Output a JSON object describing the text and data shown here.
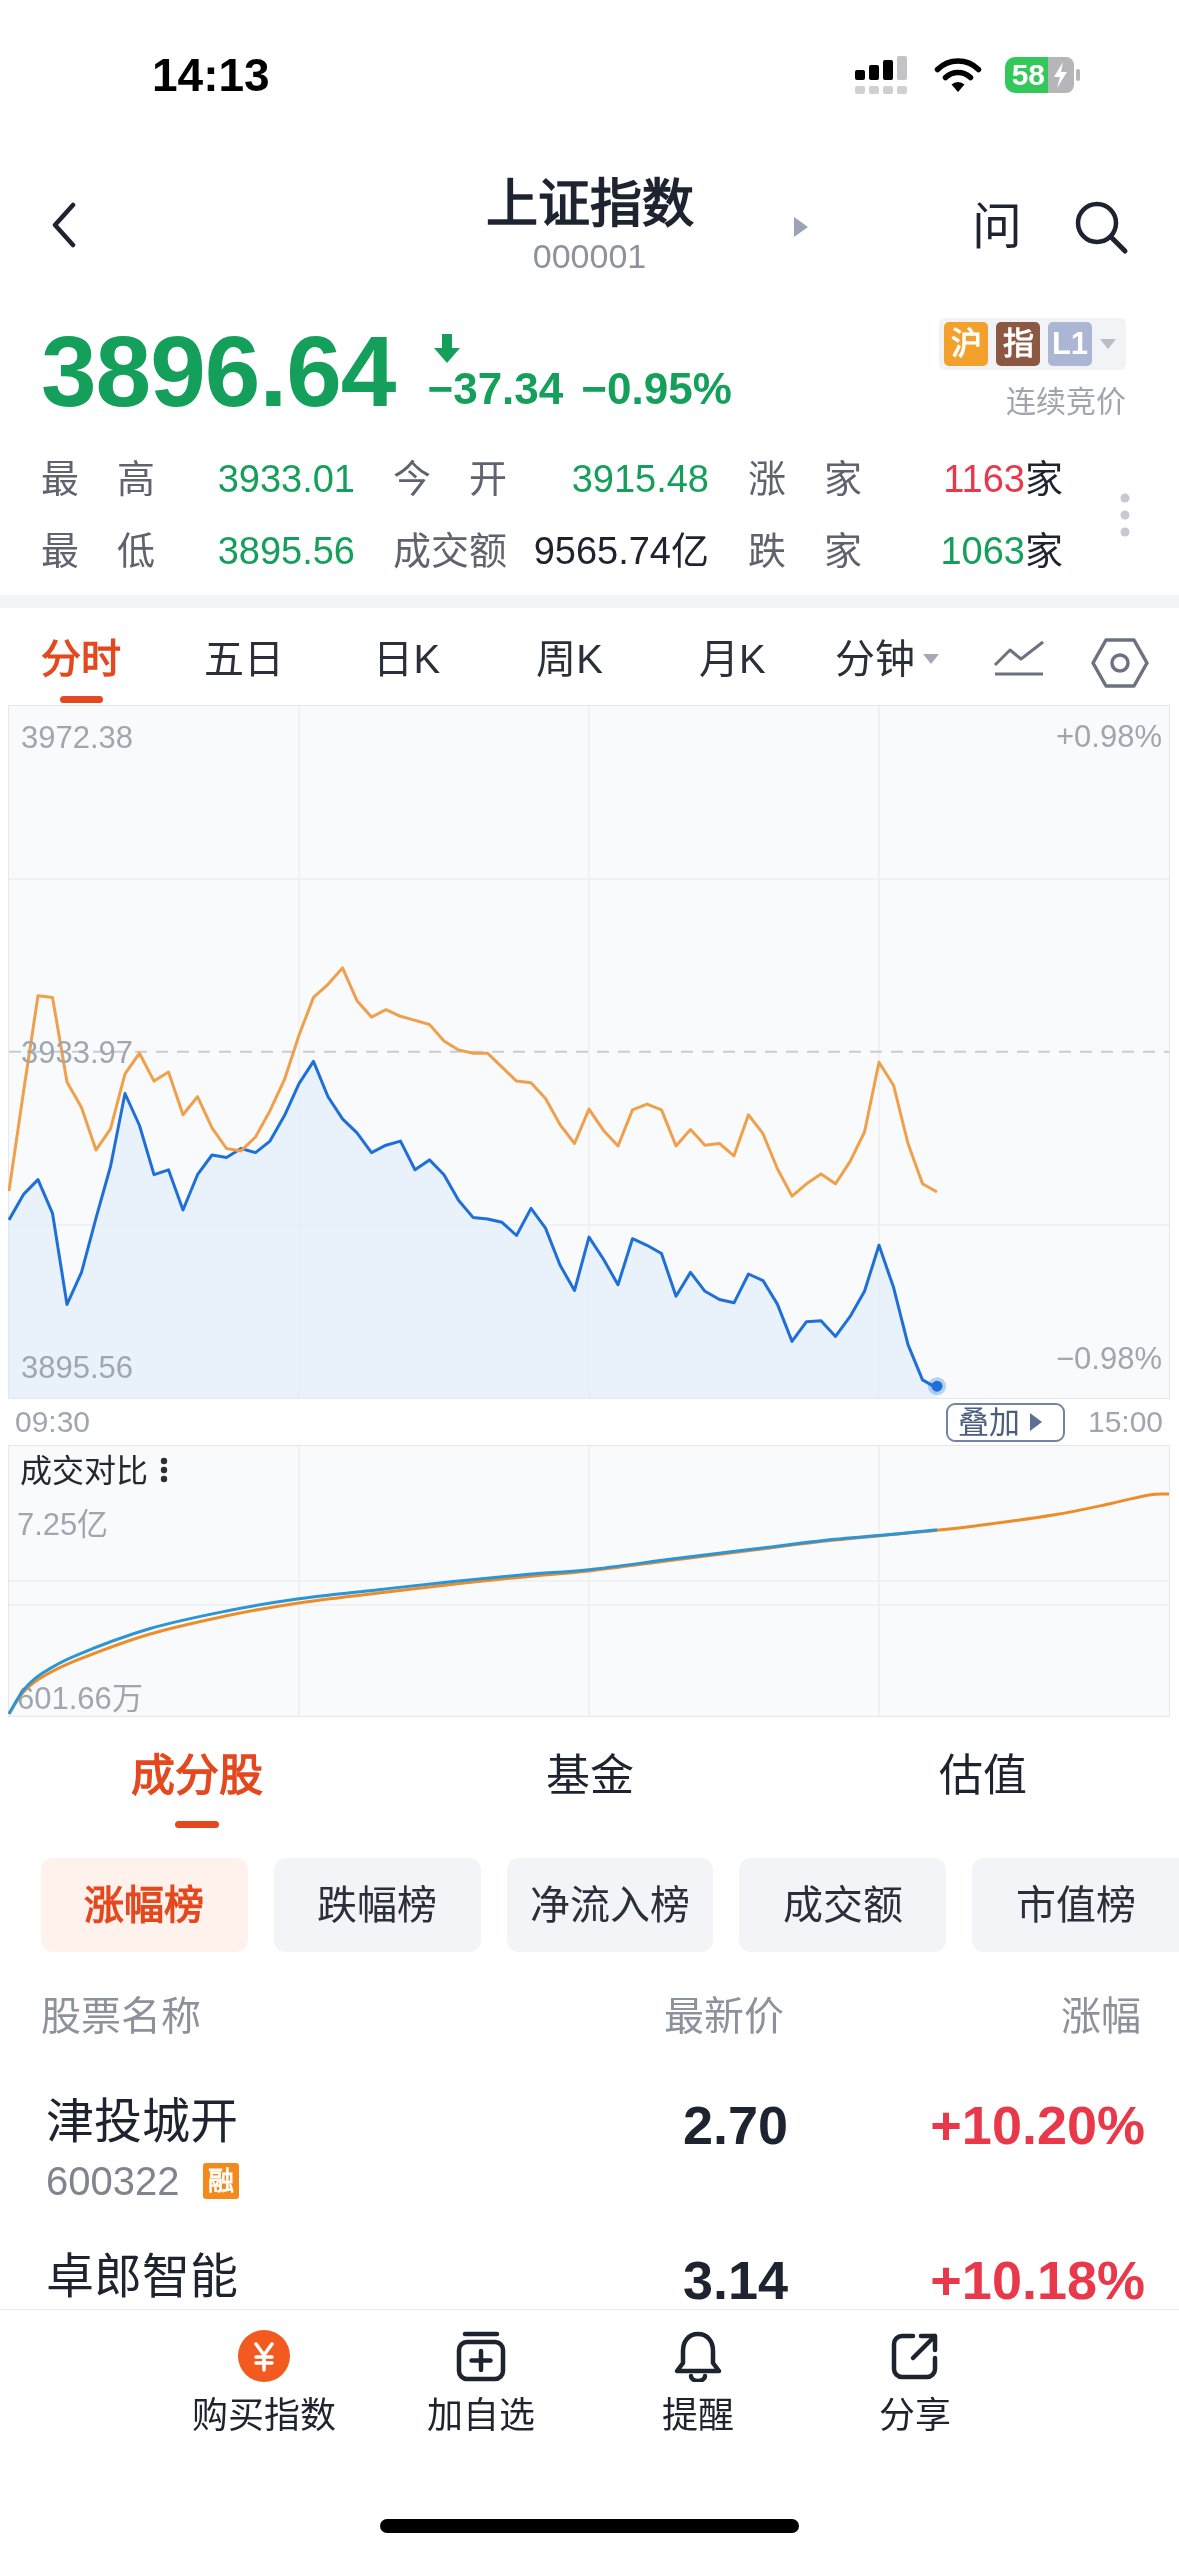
{
  "status_bar": {
    "time": "14:13",
    "battery": "58"
  },
  "header": {
    "title": "上证指数",
    "code": "000001",
    "ask_button": "问"
  },
  "quote": {
    "price": "3896.64",
    "falling": true,
    "change": "−37.34",
    "change_pct": "−0.95%",
    "tags": [
      {
        "text": "沪",
        "color": "#f2a22c"
      },
      {
        "text": "指",
        "color": "#8c5844"
      },
      {
        "text": "L1",
        "color": "#aab6d4"
      }
    ],
    "session": "连续竞价"
  },
  "stats": [
    {
      "label": "最 高",
      "value": "3933.01",
      "color": "#14a05a"
    },
    {
      "label": "今 开",
      "value": "3915.48",
      "color": "#14a05a"
    },
    {
      "label": "涨 家",
      "value": "1163",
      "unit": "家",
      "color": "#e8384a"
    },
    {
      "label": "最 低",
      "value": "3895.56",
      "color": "#14a05a"
    },
    {
      "label": "成交额",
      "value": "9565.74亿",
      "color": "#1e2330"
    },
    {
      "label": "跌 家",
      "value": "1063",
      "unit": "家",
      "color": "#14a05a"
    }
  ],
  "chart_tabs": [
    {
      "label": "分时",
      "selected": true,
      "kind": "tab"
    },
    {
      "label": "五日",
      "selected": false,
      "kind": "tab"
    },
    {
      "label": "日K",
      "selected": false,
      "kind": "tab"
    },
    {
      "label": "周K",
      "selected": false,
      "kind": "tab"
    },
    {
      "label": "月K",
      "selected": false,
      "kind": "tab"
    },
    {
      "label": "分钟",
      "selected": false,
      "kind": "dropdown"
    }
  ],
  "price_chart": {
    "chart_data": {
      "type": "line",
      "ylim": [
        3891.8,
        3976.1
      ],
      "yticks": [
        3895.56,
        3933.97,
        3972.38
      ],
      "ref_lines": [
        {
          "axis": "y",
          "value": 3933.97
        }
      ],
      "categories": [
        null,
        null,
        null,
        "09:30",
        null,
        null,
        null,
        null,
        null,
        null,
        null,
        null,
        null,
        null,
        null,
        null,
        null,
        null,
        null,
        null,
        null,
        null,
        null,
        null,
        null,
        null,
        null,
        null,
        null,
        null,
        null,
        null,
        null,
        null,
        null,
        null,
        null,
        null,
        null,
        null,
        null,
        null,
        null,
        null,
        null,
        null,
        null,
        null,
        null,
        null,
        null,
        null,
        null,
        null,
        null,
        null,
        null,
        null,
        null,
        null,
        null,
        null,
        null,
        null,
        null,
        null,
        null,
        null,
        null,
        null,
        null,
        null,
        null,
        null,
        null,
        null,
        null,
        "15:00",
        null,
        null,
        null
      ],
      "series": [
        {
          "color": "#1f6fd8",
          "values": [
            3913.5,
            3916.6,
            3918.4,
            3914.3,
            3903.2,
            3907.1,
            3913.7,
            3920.0,
            3928.9,
            3925.0,
            3919.0,
            3919.6,
            3914.7,
            3919.0,
            3921.4,
            3921.1,
            3922.2,
            3921.7,
            3923.1,
            3926.2,
            3930.1,
            3932.8,
            3928.5,
            3925.8,
            3924.1,
            3921.7,
            3922.6,
            3923.1,
            3919.6,
            3920.8,
            3919.0,
            3915.9,
            3913.8,
            3913.6,
            3913.2,
            3911.6,
            3914.9,
            3912.5,
            3908.0,
            3904.9,
            3911.4,
            3908.7,
            3905.6,
            3911.2,
            3910.4,
            3909.4,
            3904.2,
            3907.1,
            3904.8,
            3903.8,
            3903.4,
            3906.9,
            3906.1,
            3903.2,
            3898.7,
            3901.1,
            3901.2,
            3899.3,
            3901.7,
            3904.8,
            3910.4,
            3905.3,
            3898.3,
            3894.0,
            3893.0,
            null,
            null,
            null,
            null,
            null,
            null,
            null,
            null,
            null,
            null,
            null,
            null,
            null,
            null,
            null,
            null
          ]
        },
        {
          "color": "#f0a04b",
          "values": [
            3917.0,
            3929.1,
            3940.8,
            3940.6,
            3930.3,
            3927.2,
            3922.0,
            3924.6,
            3931.3,
            3933.8,
            3930.4,
            3931.5,
            3926.3,
            3928.5,
            3924.7,
            3922.2,
            3921.9,
            3923.6,
            3926.8,
            3930.6,
            3936.0,
            3940.6,
            3942.2,
            3944.2,
            3940.2,
            3938.2,
            3939.1,
            3938.3,
            3937.8,
            3937.3,
            3935.3,
            3934.2,
            3933.8,
            3933.8,
            3932.1,
            3930.4,
            3930.2,
            3928.3,
            3925.1,
            3922.8,
            3927.0,
            3924.4,
            3922.5,
            3926.9,
            3927.6,
            3926.9,
            3922.5,
            3924.5,
            3922.6,
            3922.8,
            3921.3,
            3926.3,
            3924.0,
            3919.7,
            3916.4,
            3917.9,
            3919.1,
            3917.9,
            3920.6,
            3924.2,
            3932.7,
            3929.9,
            3922.8,
            3917.9,
            3916.9,
            null,
            null,
            null,
            null,
            null,
            null,
            null,
            null,
            null,
            null,
            null,
            null,
            null,
            null,
            null,
            null
          ]
        }
      ]
    },
    "pct_high": "+0.98%",
    "pct_low": "−0.98%",
    "overlay_button": "叠加"
  },
  "volume_chart": {
    "title": "成交对比",
    "max_label": "7.25亿",
    "min_label": "601.66万"
  },
  "segment_tabs": [
    {
      "label": "成分股",
      "selected": true
    },
    {
      "label": "基金",
      "selected": false
    },
    {
      "label": "估值",
      "selected": false
    }
  ],
  "filters": [
    {
      "label": "涨幅榜",
      "selected": true
    },
    {
      "label": "跌幅榜",
      "selected": false
    },
    {
      "label": "净流入榜",
      "selected": false
    },
    {
      "label": "成交额",
      "selected": false
    },
    {
      "label": "市值榜",
      "selected": false
    }
  ],
  "table": {
    "columns": [
      "股票名称",
      "最新价",
      "涨幅"
    ],
    "rows": [
      {
        "name": "津投城开",
        "code": "600322",
        "badge": "融",
        "price": "2.70",
        "change": "+10.20%",
        "color": "#e8384a"
      },
      {
        "name": "卓郎智能",
        "price": "3.14",
        "change": "+10.18%",
        "color": "#e8384a"
      }
    ]
  },
  "bottom_bar": [
    {
      "label": "购买指数",
      "kind": "buy"
    },
    {
      "label": "加自选",
      "kind": "watchlist"
    },
    {
      "label": "提醒",
      "kind": "alert"
    },
    {
      "label": "分享",
      "kind": "share"
    }
  ]
}
